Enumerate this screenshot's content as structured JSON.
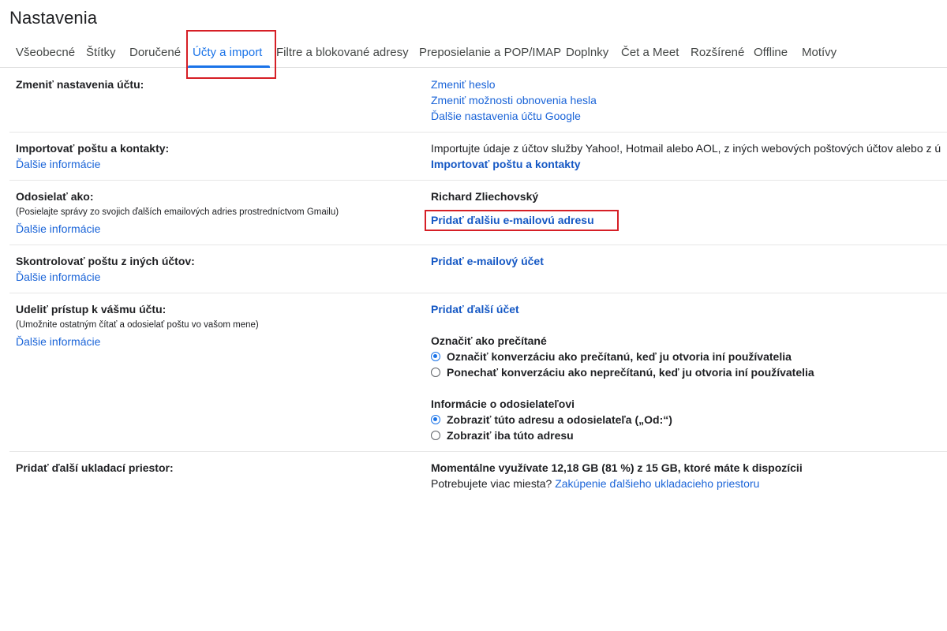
{
  "page_title": "Nastavenia",
  "tabs": [
    {
      "label": "Všeobecné"
    },
    {
      "label": "Štítky"
    },
    {
      "label": "Doručené"
    },
    {
      "label": "Účty a import"
    },
    {
      "label": "Filtre a blokované adresy"
    },
    {
      "label": "Preposielanie a POP/IMAP"
    },
    {
      "label": "Doplnky"
    },
    {
      "label": "Čet a Meet"
    },
    {
      "label": "Rozšírené"
    },
    {
      "label": "Offline"
    },
    {
      "label": "Motívy"
    }
  ],
  "active_tab": "Účty a import",
  "accent_color": "#1a73e8",
  "highlight_color": "#d61f26",
  "sections": {
    "change_account": {
      "label": "Zmeniť nastavenia účtu:",
      "links": [
        "Zmeniť heslo",
        "Zmeniť možnosti obnovenia hesla",
        "Ďalšie nastavenia účtu Google"
      ]
    },
    "import": {
      "label": "Importovať poštu a kontakty:",
      "more_info": "Ďalšie informácie",
      "description": "Importujte údaje z účtov služby Yahoo!, Hotmail alebo AOL, z iných webových poštových účtov alebo z ú",
      "action": "Importovať poštu a kontakty"
    },
    "send_as": {
      "label": "Odosielať ako:",
      "sublabel": "(Posielajte správy zo svojich ďalších emailových adries prostredníctvom Gmailu)",
      "more_info": "Ďalšie informácie",
      "name": "Richard Zliechovský",
      "action": "Pridať ďalšiu e-mailovú adresu"
    },
    "check_mail": {
      "label": "Skontrolovať poštu z iných účtov:",
      "more_info": "Ďalšie informácie",
      "action": "Pridať e-mailový účet"
    },
    "grant_access": {
      "label": "Udeliť prístup k vášmu účtu:",
      "sublabel": "(Umožnite ostatným čítať a odosielať poštu vo vašom mene)",
      "more_info": "Ďalšie informácie",
      "action": "Pridať ďalší účet",
      "mark_read_title": "Označiť ako prečítané",
      "mark_read_options": [
        {
          "label": "Označiť konverzáciu ako prečítanú, keď ju otvoria iní používatelia",
          "checked": true
        },
        {
          "label": "Ponechať konverzáciu ako neprečítanú, keď ju otvoria iní používatelia",
          "checked": false
        }
      ],
      "sender_info_title": "Informácie o odosielateľovi",
      "sender_info_options": [
        {
          "label": "Zobraziť túto adresu a odosielateľa („Od:“)",
          "checked": true
        },
        {
          "label": "Zobraziť iba túto adresu",
          "checked": false
        }
      ]
    },
    "storage": {
      "label": "Pridať ďalší ukladací priestor:",
      "usage": "Momentálne využívate 12,18 GB (81 %) z 15 GB, ktoré máte k dispozícii",
      "need_more": "Potrebujete viac miesta?",
      "buy_link": "Zakúpenie ďalšieho ukladacieho priestoru"
    }
  }
}
